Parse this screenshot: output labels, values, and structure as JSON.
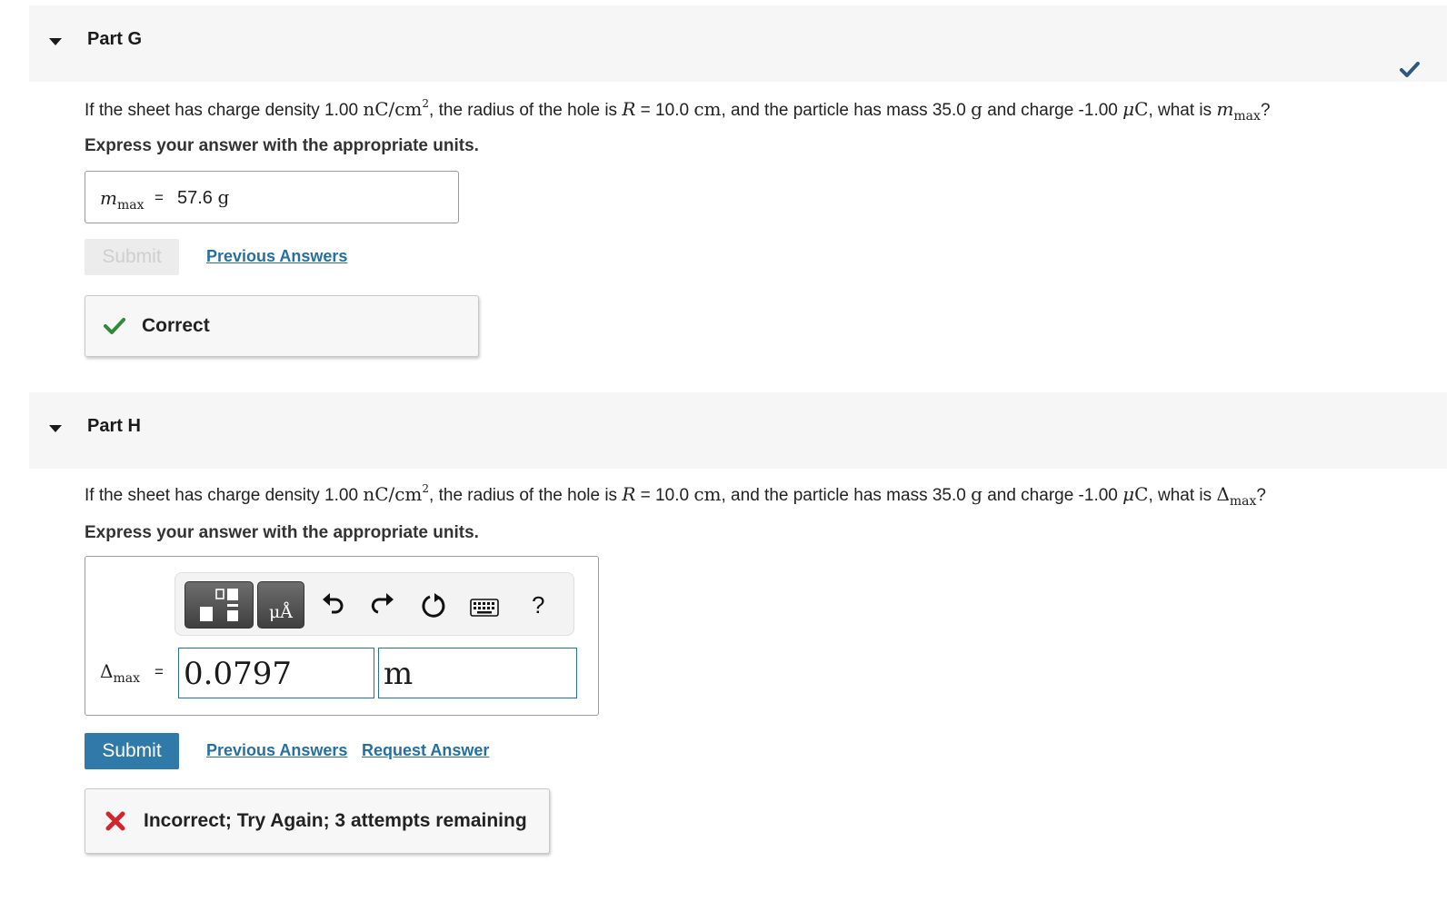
{
  "partG": {
    "title": "Part G",
    "q_if": "If the sheet has charge density 1.00 ",
    "q_density_unit": "nC/cm",
    "q_exp": "2",
    "q_radius": ", the radius of the hole is ",
    "q_R": "R",
    "q_eq": " = 10.0 ",
    "q_cm": "cm",
    "q_mass": ", and the particle has mass 35.0 ",
    "q_g": "g",
    "q_charge": " and charge -1.00 ",
    "q_mu": "μ",
    "q_C": "C",
    "q_what": ", what is ",
    "q_m": "m",
    "q_max": "max",
    "q_end": "?",
    "instruction": "Express your answer with the appropriate units.",
    "answer_var": "m",
    "answer_sub": "max",
    "answer_eq": "=",
    "answer_value": "57.6",
    "answer_unit": "g",
    "submit_label": "Submit",
    "previous_answers": "Previous Answers",
    "feedback": "Correct"
  },
  "partH": {
    "title": "Part H",
    "q_if": "If the sheet has charge density 1.00 ",
    "q_density_unit": "nC/cm",
    "q_exp": "2",
    "q_radius": ", the radius of the hole is ",
    "q_R": "R",
    "q_eq": " = 10.0 ",
    "q_cm": "cm",
    "q_mass": ", and the particle has mass 35.0 ",
    "q_g": "g",
    "q_charge": " and charge -1.00 ",
    "q_mu": "μ",
    "q_C": "C",
    "q_what": ", what is ",
    "q_delta": "Δ",
    "q_max": "max",
    "q_end": "?",
    "instruction": "Express your answer with the appropriate units.",
    "toolbar": {
      "units_label": "μÅ",
      "help_label": "?"
    },
    "answer_var": "Δ",
    "answer_sub": "max",
    "answer_eq": "=",
    "value_field": "0.0797",
    "unit_field": "m",
    "submit_label": "Submit",
    "previous_answers": "Previous Answers",
    "request_answer": "Request Answer",
    "feedback": "Incorrect; Try Again; 3 attempts remaining"
  },
  "colors": {
    "accent": "#2f7aa8",
    "correct_green": "#2e8b3a",
    "incorrect_red": "#d0262d",
    "status_check": "#2d5a80"
  },
  "icons": [
    "caret-down-icon",
    "checkmark-icon",
    "x-icon",
    "templates-icon",
    "units-icon",
    "undo-icon",
    "redo-icon",
    "reset-icon",
    "keyboard-icon",
    "help-icon"
  ]
}
